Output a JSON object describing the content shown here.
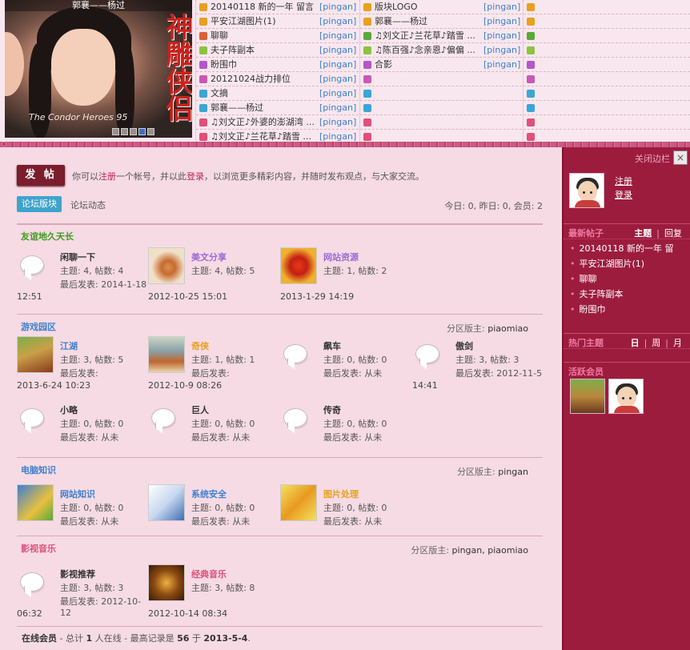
{
  "slideshow": {
    "caption": "郭襄——杨过",
    "brand": "神雕侠侣",
    "english": "The Condor Heroes 95",
    "dots": [
      "1",
      "2",
      "3",
      "4",
      "5"
    ]
  },
  "thread_col1": [
    {
      "title": "20140118 新的一年 留言",
      "user": "[pingan]",
      "color": "#e8a020"
    },
    {
      "title": "平安江湖图片(1)",
      "user": "[pingan]",
      "color": "#e8a020"
    },
    {
      "title": "聊聊",
      "user": "[pingan]",
      "color": "#d95f38"
    },
    {
      "title": "夫子阵副本",
      "user": "[pingan]",
      "color": "#8ac43f"
    },
    {
      "title": "盼围巾",
      "user": "[pingan]",
      "color": "#b557c8"
    },
    {
      "title": "20121024战力排位",
      "user": "[pingan]",
      "color": "#c759b5"
    },
    {
      "title": "文摘",
      "user": "[pingan]",
      "color": "#3aa6d6"
    },
    {
      "title": "郭襄——杨过",
      "user": "[pingan]",
      "color": "#3aa6d6"
    },
    {
      "title": "♫刘文正♪外婆的澎湖湾 ...",
      "user": "[pingan]",
      "color": "#e0507a"
    },
    {
      "title": "♫刘文正♪兰花草♪踏雪 ...",
      "user": "[pingan]",
      "color": "#e0507a"
    }
  ],
  "thread_col2": [
    {
      "title": "版块LOGO",
      "user": "[pingan]",
      "color": "#e8a020"
    },
    {
      "title": "郭襄——杨过",
      "user": "[pingan]",
      "color": "#e8a020"
    },
    {
      "title": "♫刘文正♪兰花草♪踏雪 ...",
      "user": "[pingan]",
      "color": "#5aa83a"
    },
    {
      "title": "♫陈百强♪念亲恩♪偏偏 ...",
      "user": "[pingan]",
      "color": "#8ac43f"
    },
    {
      "title": "合影",
      "user": "[pingan]",
      "color": "#b557c8"
    },
    {
      "title": "",
      "user": "",
      "color": "#c759b5"
    },
    {
      "title": "",
      "user": "",
      "color": "#3aa6d6"
    },
    {
      "title": "",
      "user": "",
      "color": "#3aa6d6"
    },
    {
      "title": "",
      "user": "",
      "color": "#e0507a"
    },
    {
      "title": "",
      "user": "",
      "color": "#e0507a"
    }
  ],
  "thread_col3_colors": [
    "#e8a020",
    "#e8a020",
    "#5aa83a",
    "#8ac43f",
    "#b557c8",
    "#c759b5",
    "#3aa6d6",
    "#3aa6d6",
    "#e0507a",
    "#e0507a"
  ],
  "main": {
    "post_button": "发 帖",
    "notice": {
      "before": "你可以",
      "register": "注册",
      "mid": "一个帐号，并以此",
      "login": "登录",
      "after": "，以浏览更多精彩内容，并随时发布观点，与大家交流。"
    },
    "tab_active": "论坛版块",
    "tab_other": "论坛动态",
    "stats": "今日: 0, 昨日: 0, 会员: 2",
    "online": {
      "label": "在线会员",
      "text1": " - 总计 ",
      "count": "1",
      "text2": " 人在线 - 最高记录是 ",
      "record": "56",
      "text3": " 于 ",
      "date": "2013-5-4",
      "end": "."
    }
  },
  "sections": [
    {
      "title": "友谊地久天长",
      "title_color": "#3f9a1e",
      "mods_label": "",
      "mods": "",
      "forums": [
        {
          "name": "闲聊一下",
          "name_color": "#333",
          "topics": "主题: 4, 帖数: 4",
          "last": "最后发表: 2014-1-18",
          "last2": "12:51",
          "icon": "bubble"
        },
        {
          "name": "美文分享",
          "name_color": "#9b6ad6",
          "topics": "主题: 4, 帖数: 5",
          "last": "",
          "last2": "2012-10-25 15:01",
          "icon": "img-hand"
        },
        {
          "name": "网站资源",
          "name_color": "#9b6ad6",
          "topics": "主题: 1, 帖数: 2",
          "last": "",
          "last2": "2013-1-29 14:19",
          "icon": "img-leaf"
        }
      ]
    },
    {
      "title": "游戏园区",
      "title_color": "#3f7fcf",
      "mods_label": "分区版主:",
      "mods": "piaomiao",
      "forums": [
        {
          "name": "江湖",
          "name_color": "#3f7fcf",
          "topics": "主题: 3, 帖数: 5",
          "last": "最后发表:",
          "last2": "2013-6-24 10:23",
          "icon": "img-jianghu"
        },
        {
          "name": "奇侠",
          "name_color": "#e8a020",
          "topics": "主题: 1, 帖数: 1",
          "last": "最后发表:",
          "last2": "2012-10-9 08:26",
          "icon": "img-qixia"
        },
        {
          "name": "飙车",
          "name_color": "#333",
          "topics": "主题: 0, 帖数: 0",
          "last": "最后发表: 从未",
          "last2": "",
          "icon": "bubble"
        },
        {
          "name": "傲剑",
          "name_color": "#333",
          "topics": "主题: 3, 帖数: 3",
          "last": "最后发表: 2012-11-5",
          "last2": "14:41",
          "icon": "bubble"
        },
        {
          "name": "小略",
          "name_color": "#333",
          "topics": "主题: 0, 帖数: 0",
          "last": "最后发表: 从未",
          "last2": "",
          "icon": "bubble"
        },
        {
          "name": "巨人",
          "name_color": "#333",
          "topics": "主题: 0, 帖数: 0",
          "last": "最后发表: 从未",
          "last2": "",
          "icon": "bubble"
        },
        {
          "name": "传奇",
          "name_color": "#333",
          "topics": "主题: 0, 帖数: 0",
          "last": "最后发表: 从未",
          "last2": "",
          "icon": "bubble"
        }
      ]
    },
    {
      "title": "电脑知识",
      "title_color": "#3f7fcf",
      "mods_label": "分区版主:",
      "mods": "pingan",
      "forums": [
        {
          "name": "网站知识",
          "name_color": "#3f7fcf",
          "topics": "主题: 0, 帖数: 0",
          "last": "最后发表: 从未",
          "last2": "",
          "icon": "img-web"
        },
        {
          "name": "系统安全",
          "name_color": "#3f7fcf",
          "topics": "主题: 0, 帖数: 0",
          "last": "最后发表: 从未",
          "last2": "",
          "icon": "img-pc"
        },
        {
          "name": "图片处理",
          "name_color": "#e8a020",
          "topics": "主题: 0, 帖数: 0",
          "last": "最后发表: 从未",
          "last2": "",
          "icon": "img-art"
        }
      ]
    },
    {
      "title": "影视音乐",
      "title_color": "#e0507a",
      "mods_label": "分区版主:",
      "mods": "pingan, piaomiao",
      "forums": [
        {
          "name": "影视推荐",
          "name_color": "#333",
          "topics": "主题: 3, 帖数: 3",
          "last": "最后发表: 2012-10-12",
          "last2": "06:32",
          "icon": "bubble"
        },
        {
          "name": "经典音乐",
          "name_color": "#e0507a",
          "topics": "主题: 3, 帖数: 8",
          "last": "",
          "last2": "2012-10-14 08:34",
          "icon": "img-music"
        }
      ]
    }
  ],
  "sidebar": {
    "close": "关闭边栏",
    "close_x": "×",
    "register": "注册",
    "login": "登录",
    "new_posts": "最新帖子",
    "np_tab1": "主题",
    "np_tab2": "回复",
    "posts": [
      "20140118 新的一年 留",
      "平安江湖图片(1)",
      "聊聊",
      "夫子阵副本",
      "盼围巾"
    ],
    "hot": "热门主题",
    "hot_tabs": [
      "日",
      "周",
      "月"
    ],
    "active": "活跃会员"
  }
}
